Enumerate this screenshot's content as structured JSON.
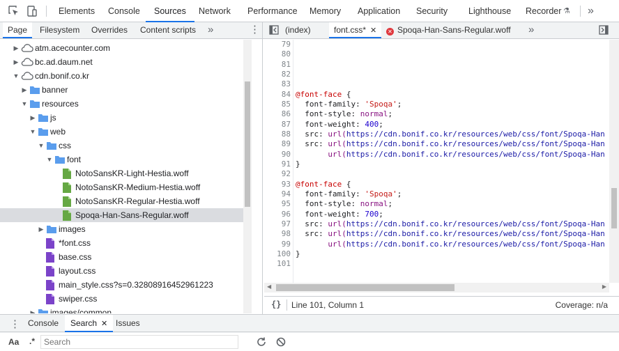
{
  "toolbar": {
    "tabs": [
      "Elements",
      "Console",
      "Sources",
      "Network",
      "Performance",
      "Memory",
      "Application",
      "Security",
      "Lighthouse",
      "Recorder"
    ],
    "active_tab": "Sources",
    "more": "»"
  },
  "navigator": {
    "tabs": [
      "Page",
      "Filesystem",
      "Overrides",
      "Content scripts"
    ],
    "more": "»",
    "menu": "⋮",
    "tree": [
      {
        "label": "atm.acecounter.com",
        "type": "domain",
        "expanded": false
      },
      {
        "label": "bc.ad.daum.net",
        "type": "domain",
        "expanded": false
      },
      {
        "label": "cdn.bonif.co.kr",
        "type": "domain",
        "expanded": true
      },
      {
        "label": "banner",
        "type": "folder",
        "expanded": false
      },
      {
        "label": "resources",
        "type": "folder",
        "expanded": true
      },
      {
        "label": "js",
        "type": "folder",
        "expanded": false
      },
      {
        "label": "web",
        "type": "folder",
        "expanded": true
      },
      {
        "label": "css",
        "type": "folder",
        "expanded": true
      },
      {
        "label": "font",
        "type": "folder",
        "expanded": true
      },
      {
        "label": "NotoSansKR-Light-Hestia.woff",
        "type": "font-file"
      },
      {
        "label": "NotoSansKR-Medium-Hestia.woff",
        "type": "font-file"
      },
      {
        "label": "NotoSansKR-Regular-Hestia.woff",
        "type": "font-file"
      },
      {
        "label": "Spoqa-Han-Sans-Regular.woff",
        "type": "font-file",
        "selected": true
      },
      {
        "label": "images",
        "type": "folder",
        "expanded": false
      },
      {
        "label": "*font.css",
        "type": "css-file"
      },
      {
        "label": "base.css",
        "type": "css-file"
      },
      {
        "label": "layout.css",
        "type": "css-file"
      },
      {
        "label": "main_style.css?s=0.32808916452961223",
        "type": "css-file"
      },
      {
        "label": "swiper.css",
        "type": "css-file"
      },
      {
        "label": "images/common",
        "type": "folder",
        "expanded": false
      }
    ]
  },
  "editor": {
    "tabs": [
      {
        "label": "(index)",
        "active": false,
        "close": ""
      },
      {
        "label": "font.css*",
        "active": true,
        "close": "✕"
      },
      {
        "label": "Spoqa-Han-Sans-Regular.woff",
        "active": false,
        "close": "",
        "error": true
      }
    ],
    "more": "»",
    "lines": [
      {
        "n": "79",
        "parts": []
      },
      {
        "n": "80",
        "parts": []
      },
      {
        "n": "81",
        "parts": []
      },
      {
        "n": "82",
        "parts": []
      },
      {
        "n": "83",
        "parts": []
      },
      {
        "n": "84",
        "parts": [
          {
            "c": "k-at",
            "t": "@font-face"
          },
          {
            "c": "k-prop",
            "t": " {"
          }
        ]
      },
      {
        "n": "85",
        "parts": [
          {
            "c": "k-prop",
            "t": "  font-family: "
          },
          {
            "c": "k-str",
            "t": "'Spoqa'"
          },
          {
            "c": "k-prop",
            "t": ";"
          }
        ]
      },
      {
        "n": "86",
        "parts": [
          {
            "c": "k-prop",
            "t": "  font-style: "
          },
          {
            "c": "k-kw",
            "t": "normal"
          },
          {
            "c": "k-prop",
            "t": ";"
          }
        ]
      },
      {
        "n": "87",
        "parts": [
          {
            "c": "k-prop",
            "t": "  font-weight: "
          },
          {
            "c": "k-num",
            "t": "400"
          },
          {
            "c": "k-prop",
            "t": ";"
          }
        ]
      },
      {
        "n": "88",
        "parts": [
          {
            "c": "k-prop",
            "t": "  src: "
          },
          {
            "c": "k-kw",
            "t": "url("
          },
          {
            "c": "k-url",
            "t": "https://cdn.bonif.co.kr/resources/web/css/font/Spoqa-Han"
          }
        ]
      },
      {
        "n": "89",
        "parts": [
          {
            "c": "k-prop",
            "t": "  src: "
          },
          {
            "c": "k-kw",
            "t": "url("
          },
          {
            "c": "k-url",
            "t": "https://cdn.bonif.co.kr/resources/web/css/font/Spoqa-Han"
          }
        ]
      },
      {
        "n": "90",
        "parts": [
          {
            "c": "k-prop",
            "t": "       "
          },
          {
            "c": "k-kw",
            "t": "url("
          },
          {
            "c": "k-url",
            "t": "https://cdn.bonif.co.kr/resources/web/css/font/Spoqa-Han"
          }
        ]
      },
      {
        "n": "91",
        "parts": [
          {
            "c": "k-prop",
            "t": "}"
          }
        ]
      },
      {
        "n": "92",
        "parts": []
      },
      {
        "n": "93",
        "parts": [
          {
            "c": "k-at",
            "t": "@font-face"
          },
          {
            "c": "k-prop",
            "t": " {"
          }
        ]
      },
      {
        "n": "94",
        "parts": [
          {
            "c": "k-prop",
            "t": "  font-family: "
          },
          {
            "c": "k-str",
            "t": "'Spoqa'"
          },
          {
            "c": "k-prop",
            "t": ";"
          }
        ]
      },
      {
        "n": "95",
        "parts": [
          {
            "c": "k-prop",
            "t": "  font-style: "
          },
          {
            "c": "k-kw",
            "t": "normal"
          },
          {
            "c": "k-prop",
            "t": ";"
          }
        ]
      },
      {
        "n": "96",
        "parts": [
          {
            "c": "k-prop",
            "t": "  font-weight: "
          },
          {
            "c": "k-num",
            "t": "700"
          },
          {
            "c": "k-prop",
            "t": ";"
          }
        ]
      },
      {
        "n": "97",
        "parts": [
          {
            "c": "k-prop",
            "t": "  src: "
          },
          {
            "c": "k-kw",
            "t": "url("
          },
          {
            "c": "k-url",
            "t": "https://cdn.bonif.co.kr/resources/web/css/font/Spoqa-Han"
          }
        ]
      },
      {
        "n": "98",
        "parts": [
          {
            "c": "k-prop",
            "t": "  src: "
          },
          {
            "c": "k-kw",
            "t": "url("
          },
          {
            "c": "k-url",
            "t": "https://cdn.bonif.co.kr/resources/web/css/font/Spoqa-Han"
          }
        ]
      },
      {
        "n": "99",
        "parts": [
          {
            "c": "k-prop",
            "t": "       "
          },
          {
            "c": "k-kw",
            "t": "url("
          },
          {
            "c": "k-url",
            "t": "https://cdn.bonif.co.kr/resources/web/css/font/Spoqa-Han"
          }
        ]
      },
      {
        "n": "100",
        "parts": [
          {
            "c": "k-prop",
            "t": "}"
          }
        ]
      },
      {
        "n": "101",
        "parts": []
      }
    ]
  },
  "status": {
    "braces": "{}",
    "position": "Line 101, Column 1",
    "coverage": "Coverage: n/a"
  },
  "drawer": {
    "menu": "⋮",
    "tabs": [
      {
        "label": "Console",
        "active": false
      },
      {
        "label": "Search",
        "active": true,
        "close": "✕"
      },
      {
        "label": "Issues",
        "active": false
      }
    ],
    "search": {
      "match_case": "Aa",
      "regex": ".*",
      "placeholder": "Search"
    }
  },
  "colors": {
    "accent": "#1a73e8",
    "folder": "#5a9ded",
    "font_file": "#66a844",
    "css_file": "#7b43c9",
    "error": "#e0393e"
  }
}
